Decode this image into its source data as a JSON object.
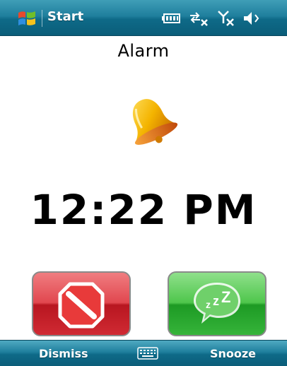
{
  "status_bar": {
    "start_label": "Start",
    "icons": [
      "windows-logo-icon",
      "battery-icon",
      "data-connection-off-icon",
      "signal-off-icon",
      "volume-icon"
    ]
  },
  "alarm": {
    "title": "Alarm",
    "time": "12:22 PM",
    "icon": "bell-icon"
  },
  "buttons": {
    "dismiss_icon": "no-entry-icon",
    "snooze_icon": "zzz-speech-bubble-icon"
  },
  "softkeys": {
    "left": "Dismiss",
    "center_icon": "keyboard-icon",
    "right": "Snooze"
  },
  "colors": {
    "bar": "#1f7f9d",
    "dismiss": "#d02a33",
    "snooze": "#36b43a",
    "bell": "#f2a900"
  }
}
